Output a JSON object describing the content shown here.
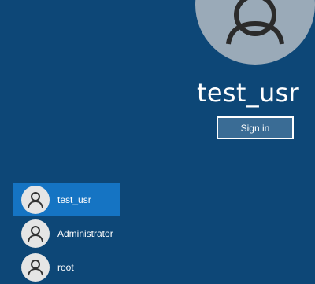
{
  "selected_user": {
    "name": "test_usr",
    "avatar_icon": "user-silhouette-icon",
    "sign_in_label": "Sign in"
  },
  "users": [
    {
      "name": "test_usr",
      "selected": true,
      "icon": "user-icon"
    },
    {
      "name": "Administrator",
      "selected": false,
      "icon": "user-icon"
    },
    {
      "name": "root",
      "selected": false,
      "icon": "user-icon"
    }
  ],
  "colors": {
    "background": "#0d4777",
    "selected_item": "#1574c3",
    "sign_in_button": "#3a6c95",
    "avatar_large": "#9aaab8",
    "avatar_small": "#e5e5e5"
  }
}
